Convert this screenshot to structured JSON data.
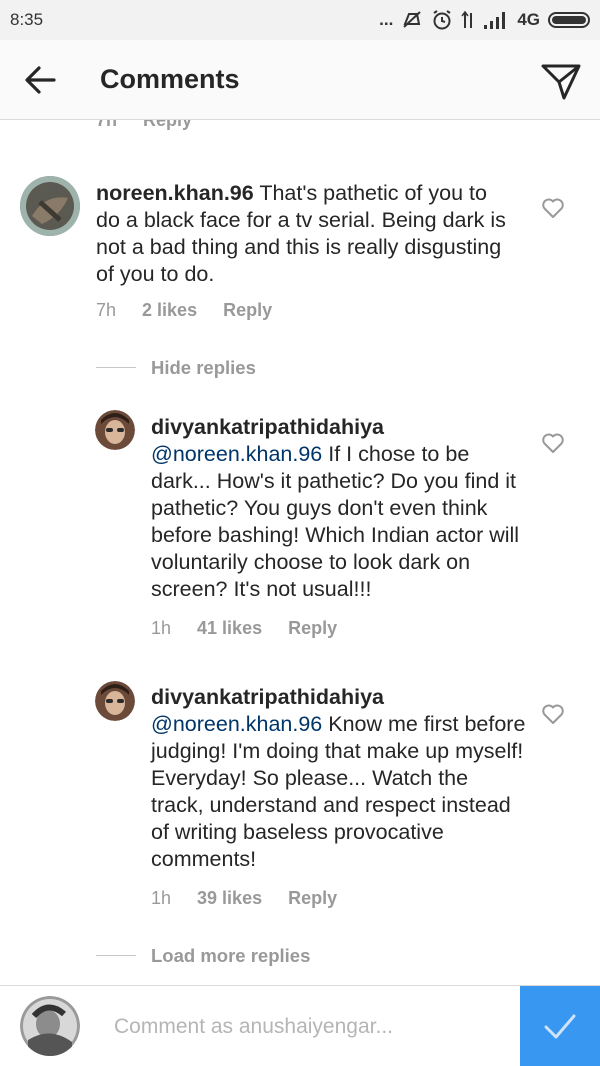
{
  "status_bar": {
    "time": "8:35",
    "dots": "...",
    "network": "4G",
    "icons": [
      "mute-icon",
      "alarm-icon",
      "data-arrows-icon",
      "signal-icon",
      "battery-icon"
    ]
  },
  "header": {
    "title": "Comments",
    "back_icon": "back-arrow-icon",
    "send_icon": "direct-send-icon"
  },
  "top_partial": {
    "time": "7h",
    "reply": "Reply"
  },
  "comment": {
    "username": "noreen.khan.96",
    "text": "That's pathetic of you to do a black face for a tv serial. Being dark is not a bad thing and this is really disgusting of you to do.",
    "time": "7h",
    "likes": "2 likes",
    "reply": "Reply"
  },
  "hide_replies": "Hide replies",
  "replies": [
    {
      "username": "divyankatripathidahiya",
      "mention": "@noreen.khan.96",
      "text": "If I chose to be dark... How's it pathetic? Do you find it pathetic? You guys don't even think before bashing! Which Indian actor will voluntarily choose to look dark on screen? It's not usual!!!",
      "time": "1h",
      "likes": "41 likes",
      "reply": "Reply"
    },
    {
      "username": "divyankatripathidahiya",
      "mention": "@noreen.khan.96",
      "text": "Know me first before judging! I'm doing that make up myself! Everyday! So please... Watch the track, understand and respect instead of writing baseless provocative comments!",
      "time": "1h",
      "likes": "39 likes",
      "reply": "Reply"
    }
  ],
  "load_more": "Load more replies",
  "composer": {
    "placeholder": "Comment as anushaiyengar...",
    "value": "",
    "post_icon": "checkmark-icon"
  },
  "colors": {
    "mention": "#003569",
    "muted": "#999999",
    "post_button": "#3897f0"
  }
}
